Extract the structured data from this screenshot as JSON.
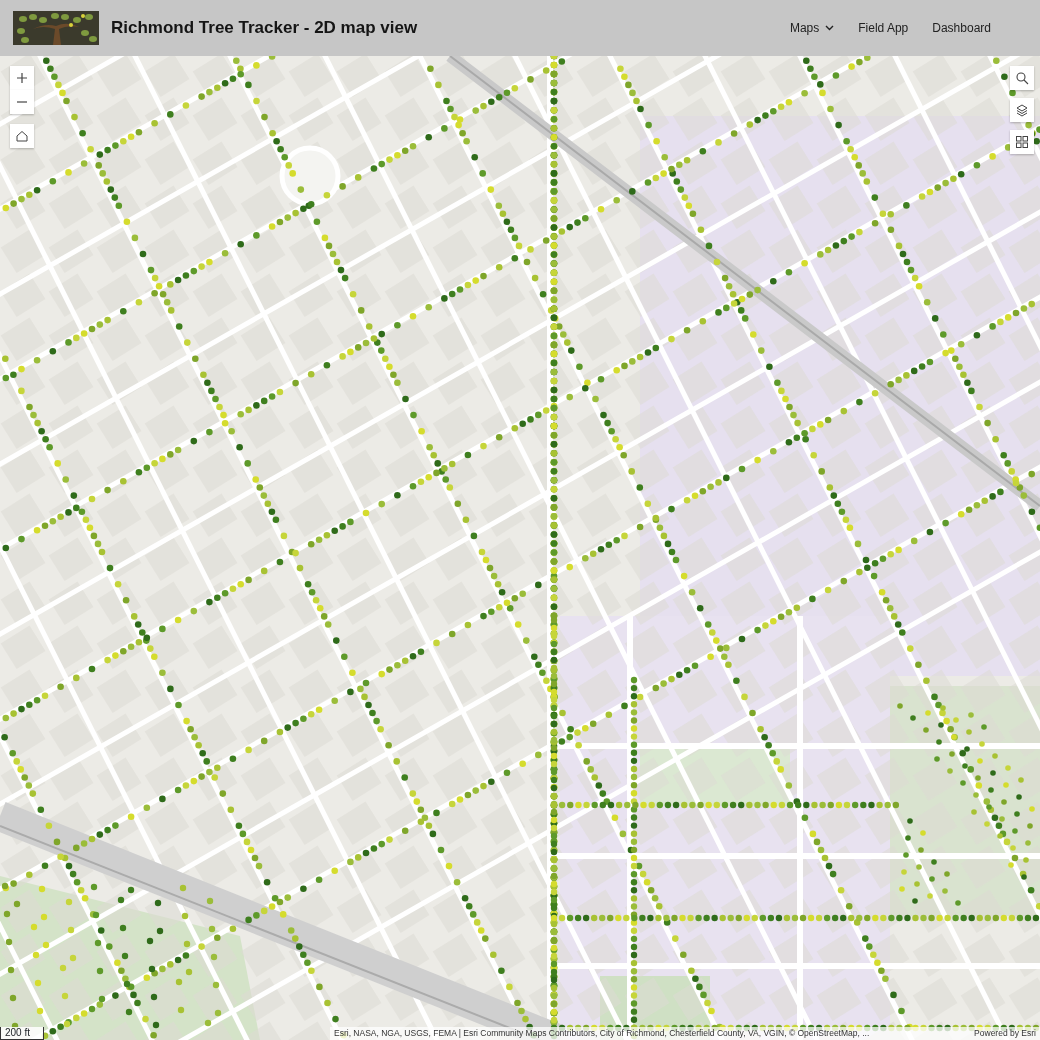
{
  "header": {
    "title": "Richmond Tree Tracker - 2D map view"
  },
  "nav": [
    {
      "label": "Maps",
      "kind": "dropdown"
    },
    {
      "label": "Field App",
      "kind": "link"
    },
    {
      "label": "Dashboard",
      "kind": "link"
    }
  ],
  "map_controls_left": [
    {
      "kind": "zoom_in"
    },
    {
      "kind": "zoom_out"
    },
    {
      "kind": "home"
    }
  ],
  "map_controls_right": [
    {
      "kind": "search"
    },
    {
      "kind": "layers"
    },
    {
      "kind": "grid"
    }
  ],
  "scale_bar": {
    "label": "200 ft"
  },
  "attribution": {
    "text": "Esri, NASA, NGA, USGS, FEMA | Esri Community Maps Contributors, City of Richmond, Chesterfield County, VA, VGIN, © OpenStreetMap, ...",
    "powered_by": "Powered by Esri"
  }
}
